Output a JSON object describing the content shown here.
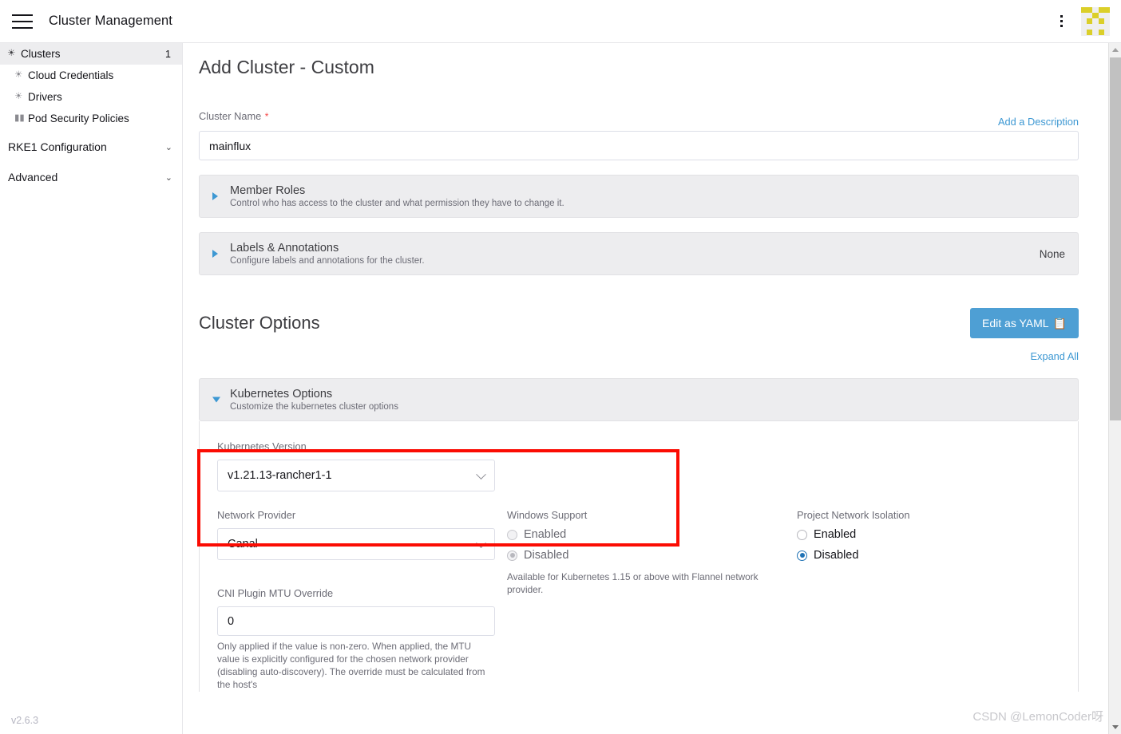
{
  "topbar": {
    "menu_icon": "hamburger-icon",
    "title": "Cluster Management",
    "kebab_icon": "more-vertical-icon",
    "avatar_icon": "user-avatar-identicon",
    "avatar_color": "#dbcf29"
  },
  "sidebar": {
    "items": [
      {
        "label": "Clusters",
        "icon": "globe-icon",
        "count": "1",
        "active": true
      },
      {
        "label": "Cloud Credentials",
        "icon": "globe-icon",
        "count": "",
        "active": false
      },
      {
        "label": "Drivers",
        "icon": "globe-icon",
        "count": "",
        "active": false
      },
      {
        "label": "Pod Security Policies",
        "icon": "folder-icon",
        "count": "",
        "active": false
      }
    ],
    "groups": [
      {
        "label": "RKE1 Configuration",
        "chevron": "chevron-down-icon"
      },
      {
        "label": "Advanced",
        "chevron": "chevron-down-icon"
      }
    ],
    "version": "v2.6.3"
  },
  "main": {
    "page_title": "Add Cluster - Custom",
    "cluster_name": {
      "label": "Cluster Name",
      "required_marker": "*",
      "value": "mainflux",
      "placeholder": "",
      "add_description_link": "Add a Description"
    },
    "accordions": [
      {
        "title": "Member Roles",
        "subtitle": "Control who has access to the cluster and what permission they have to change it.",
        "right": "",
        "open": false
      },
      {
        "title": "Labels & Annotations",
        "subtitle": "Configure labels and annotations for the cluster.",
        "right": "None",
        "open": false
      }
    ],
    "cluster_options": {
      "section_title": "Cluster Options",
      "yaml_button": "Edit as YAML",
      "yaml_button_icon": "clipboard-icon",
      "yaml_button_color": "#4e9fd4",
      "expand_all": "Expand All",
      "kubernetes_options": {
        "title": "Kubernetes Options",
        "subtitle": "Customize the kubernetes cluster options",
        "open": true
      },
      "kubernetes_version": {
        "label": "Kubernetes Version",
        "value": "v1.21.13-rancher1-1",
        "caret": "chevron-down-icon",
        "highlight_color": "#fb0c03"
      },
      "network_provider": {
        "label": "Network Provider",
        "value": "Canal",
        "caret": "chevron-down-icon"
      },
      "windows_support": {
        "label": "Windows Support",
        "options": [
          "Enabled",
          "Disabled"
        ],
        "selected": "Disabled",
        "disabled": true,
        "helper": "Available for Kubernetes 1.15 or above with Flannel network provider."
      },
      "project_network_isolation": {
        "label": "Project Network Isolation",
        "options": [
          "Enabled",
          "Disabled"
        ],
        "selected": "Disabled",
        "disabled": false
      },
      "cni_mtu_override": {
        "label": "CNI Plugin MTU Override",
        "value": "0",
        "helper": "Only applied if the value is non-zero. When applied, the MTU value is explicitly configured for the chosen network provider (disabling auto-discovery). The override must be calculated from the host's"
      }
    }
  },
  "watermark": "CSDN @LemonCoder呀"
}
